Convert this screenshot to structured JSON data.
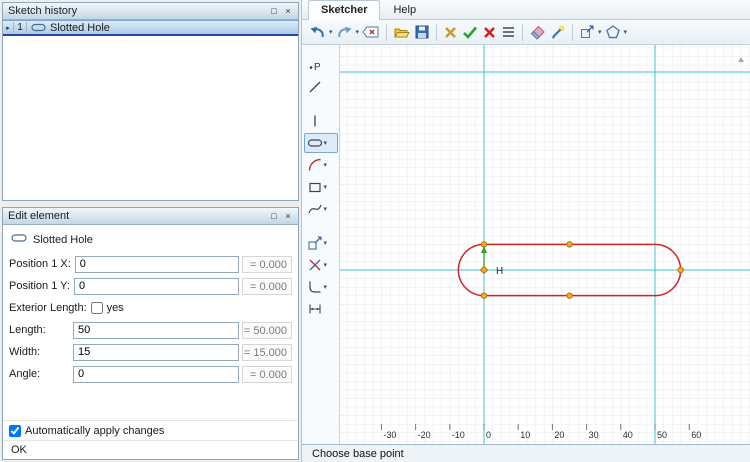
{
  "ui": {
    "dropdown_glyph": "▾",
    "row_marker": "▸",
    "maximize_glyph": "□",
    "close_glyph": "×"
  },
  "sketch_history": {
    "title": "Sketch history",
    "rows": [
      {
        "num": "1",
        "label": "Slotted Hole"
      }
    ]
  },
  "edit_element": {
    "title": "Edit element",
    "element_type": "Slotted Hole",
    "fields": [
      {
        "type": "input",
        "label": "Position 1 X:",
        "value": "0",
        "result": "= 0.000"
      },
      {
        "type": "input",
        "label": "Position 1 Y:",
        "value": "0",
        "result": "= 0.000"
      },
      {
        "type": "checkbox",
        "label": "Exterior Length:",
        "option": "yes",
        "checked": false
      },
      {
        "type": "input",
        "label": "Length:",
        "value": "50",
        "result": "= 50.000"
      },
      {
        "type": "input",
        "label": "Width:",
        "value": "15",
        "result": "= 15.000"
      },
      {
        "type": "input",
        "label": "Angle:",
        "value": "0",
        "result": "= 0.000"
      }
    ],
    "auto_apply": {
      "label": "Automatically apply changes",
      "checked": true
    },
    "footer_status": "OK"
  },
  "ribbon": {
    "tabs": [
      {
        "label": "Sketcher",
        "active": true
      },
      {
        "label": "Help",
        "active": false
      }
    ]
  },
  "toolbar": {
    "buttons": [
      "undo",
      "redo",
      "delete-element",
      "open",
      "save",
      "discard",
      "accept",
      "cancel",
      "menu",
      "eraser",
      "format-pen",
      "fit-view",
      "shape-tool"
    ]
  },
  "tool_palette": {
    "tools": [
      "point",
      "line",
      "vertical-line",
      "slotted-hole",
      "arc",
      "rectangle",
      "spline",
      "transform",
      "trim",
      "corner",
      "dimension"
    ],
    "selected": "slotted-hole"
  },
  "canvas": {
    "origin_label": "H",
    "ruler_ticks": [
      -30,
      -20,
      -10,
      0,
      10,
      20,
      30,
      40,
      50,
      60
    ],
    "slot": {
      "length": 50,
      "width": 15
    },
    "colors": {
      "shape": "#d42222",
      "axis": "#3fc6cb",
      "point_fill": "#ffaa22",
      "point_stroke": "#b07010",
      "arrow": "#2da02d"
    }
  },
  "status_bar": {
    "text": "Choose base point"
  }
}
